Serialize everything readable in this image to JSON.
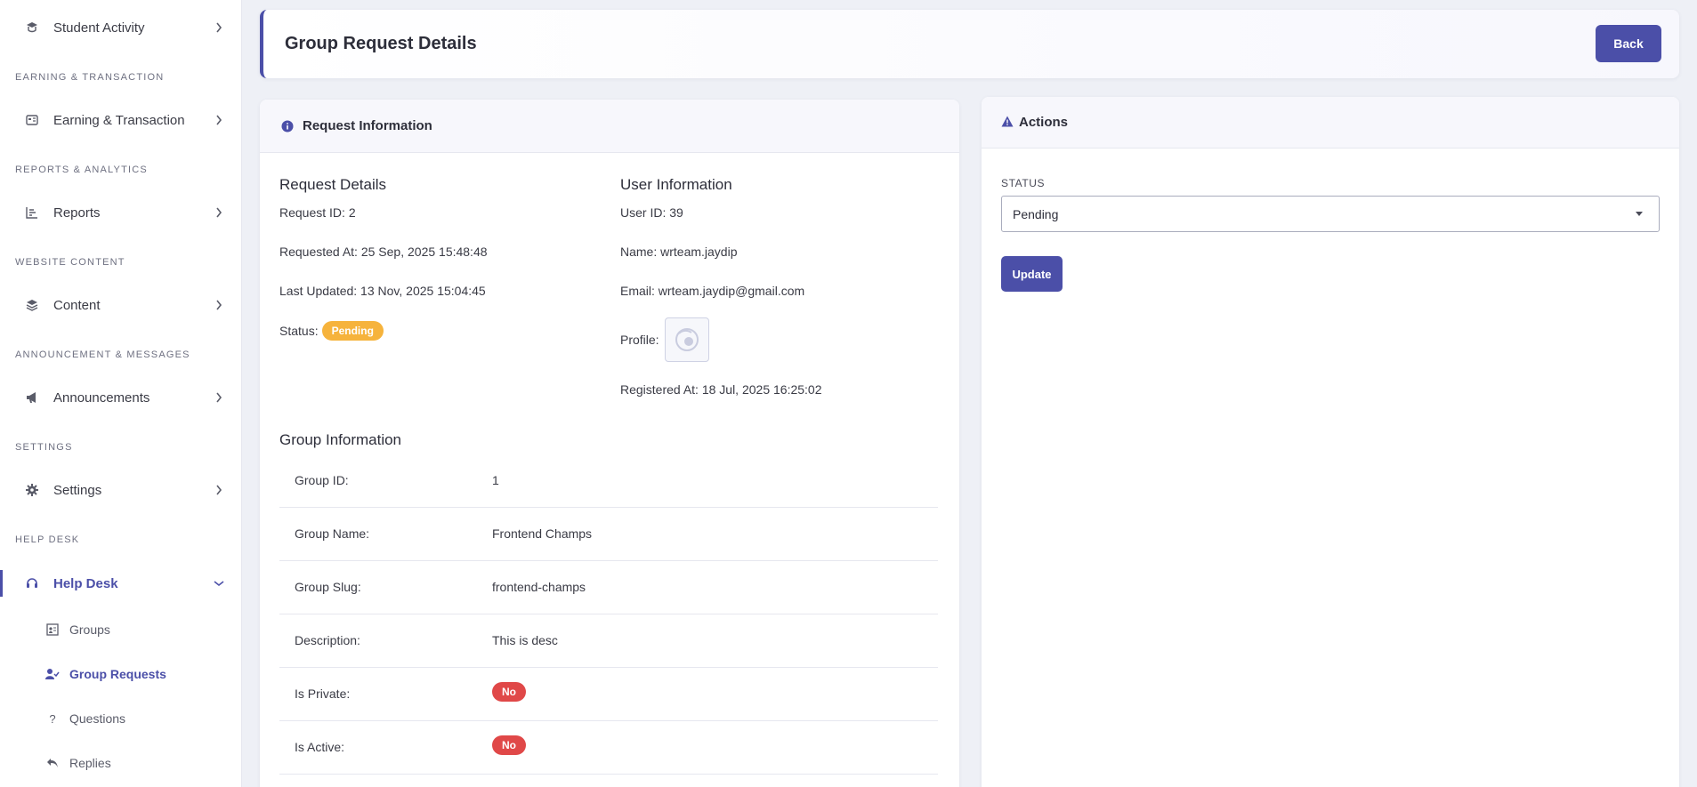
{
  "sidebar": {
    "items": [
      {
        "label": "Student Activity",
        "icon": "graduation-icon"
      },
      {
        "label": "Earning & Transaction",
        "icon": "receipt-icon"
      },
      {
        "label": "Reports",
        "icon": "bar-chart-icon"
      },
      {
        "label": "Content",
        "icon": "layers-icon"
      },
      {
        "label": "Announcements",
        "icon": "megaphone-icon"
      },
      {
        "label": "Settings",
        "icon": "gear-icon"
      },
      {
        "label": "Help Desk",
        "icon": "headset-icon"
      }
    ],
    "sections": [
      "EARNING & TRANSACTION",
      "REPORTS & ANALYTICS",
      "WEBSITE CONTENT",
      "ANNOUNCEMENT & MESSAGES",
      "SETTINGS",
      "HELP DESK"
    ],
    "subitems": [
      {
        "label": "Groups",
        "icon": "groups-icon"
      },
      {
        "label": "Group Requests",
        "icon": "user-check-icon"
      },
      {
        "label": "Questions",
        "icon": "question-icon"
      },
      {
        "label": "Replies",
        "icon": "reply-icon"
      }
    ]
  },
  "header": {
    "title": "Group Request Details",
    "back_label": "Back"
  },
  "request_card": {
    "title": "Request Information",
    "request_details": {
      "heading": "Request Details",
      "request_id": "Request ID: 2",
      "requested_at": "Requested At: 25 Sep, 2025 15:48:48",
      "last_updated": "Last Updated: 13 Nov, 2025 15:04:45",
      "status_label": "Status:",
      "status_badge": "Pending"
    },
    "user_information": {
      "heading": "User Information",
      "user_id": "User ID: 39",
      "name": "Name: wrteam.jaydip",
      "email": "Email: wrteam.jaydip@gmail.com",
      "profile_label": "Profile:",
      "registered_at": "Registered At: 18 Jul, 2025 16:25:02"
    },
    "group_information": {
      "heading": "Group Information",
      "rows": [
        {
          "label": "Group ID:",
          "value": "1"
        },
        {
          "label": "Group Name:",
          "value": "Frontend Champs"
        },
        {
          "label": "Group Slug:",
          "value": "frontend-champs"
        },
        {
          "label": "Description:",
          "value": "This is desc"
        },
        {
          "label": "Is Private:",
          "value": "No"
        },
        {
          "label": "Is Active:",
          "value": "No"
        }
      ]
    }
  },
  "actions_card": {
    "title": "Actions",
    "status_label": "STATUS",
    "status_value": "Pending",
    "update_label": "Update"
  },
  "colors": {
    "accent": "#4b4fa8",
    "pending": "#f6b33c",
    "danger": "#e04848"
  }
}
